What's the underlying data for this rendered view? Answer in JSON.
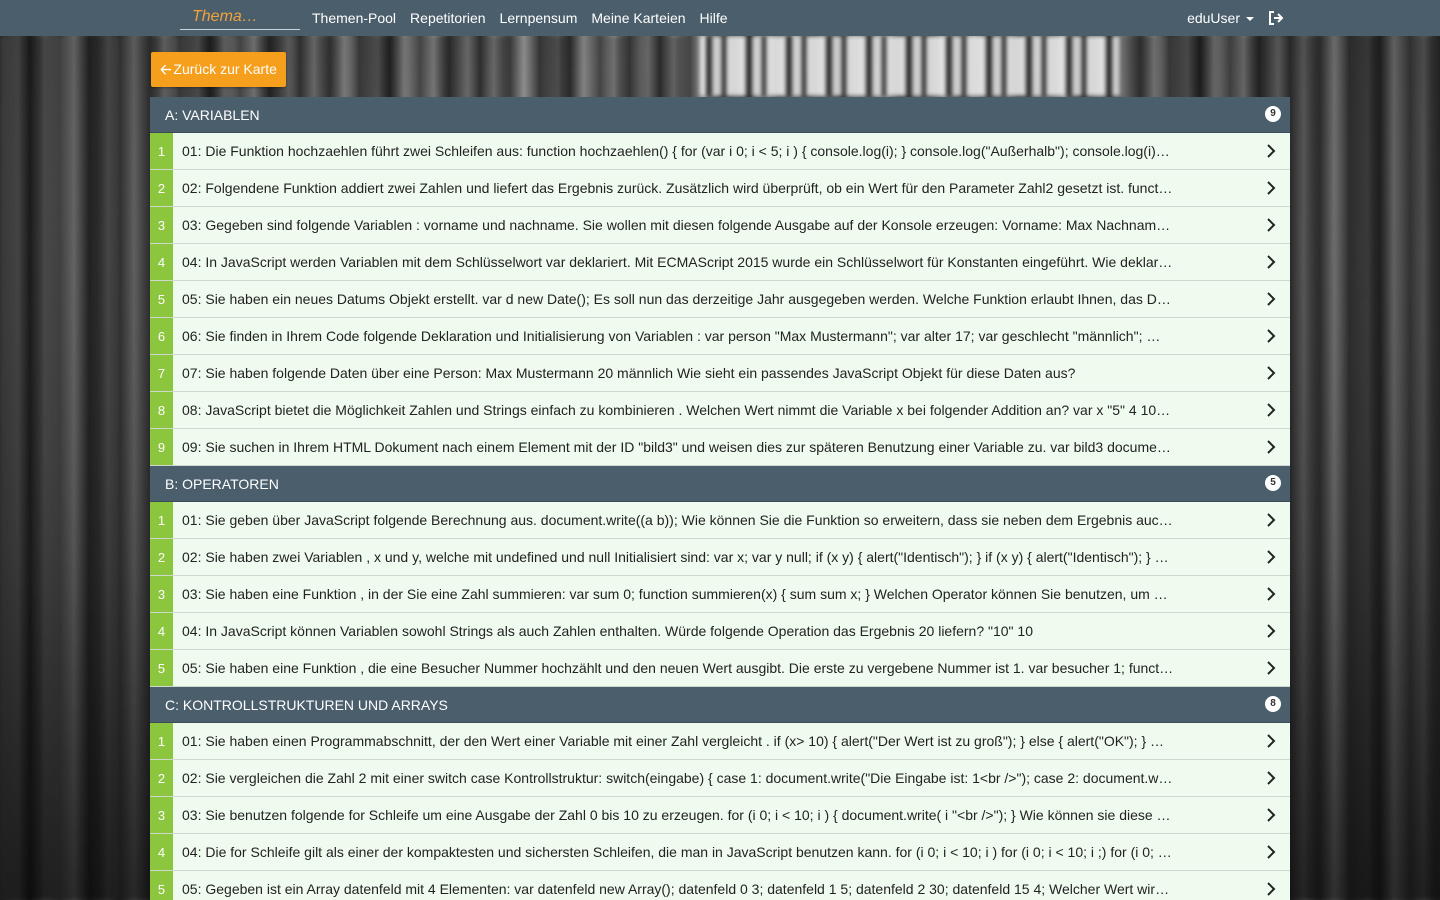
{
  "navbar": {
    "search_placeholder": "Thema…",
    "links": [
      "Themen-Pool",
      "Repetitorien",
      "Lernpensum",
      "Meine Karteien",
      "Hilfe"
    ],
    "user": "eduUser"
  },
  "back_button": {
    "label": "Zurück zur Karte"
  },
  "sections": [
    {
      "title": "A: VARIABLEN",
      "count": "9",
      "items": [
        {
          "num": "1",
          "text": "01: Die Funktion hochzaehlen führt zwei Schleifen aus: function hochzaehlen() { for (var i 0; i < 5; i ) { console.log(i); } console.log(\"Außerhalb\"); console.log(i)…"
        },
        {
          "num": "2",
          "text": "02: Folgendene Funktion addiert zwei Zahlen und liefert das Ergebnis zurück. Zusätzlich wird überprüft, ob ein Wert für den Parameter Zahl2 gesetzt ist. funct…"
        },
        {
          "num": "3",
          "text": "03: Gegeben sind folgende Variablen : vorname und nachname. Sie wollen mit diesen folgende Ausgabe auf der Konsole erzeugen: Vorname: Max Nachnam…"
        },
        {
          "num": "4",
          "text": "04: In JavaScript werden Variablen mit dem Schlüsselwort var deklariert. Mit ECMAScript 2015 wurde ein Schlüsselwort für Konstanten eingeführt. Wie deklar…"
        },
        {
          "num": "5",
          "text": "05: Sie haben ein neues Datums Objekt erstellt. var d new Date(); Es soll nun das derzeitige Jahr ausgegeben werden. Welche Funktion erlaubt Ihnen, das D…"
        },
        {
          "num": "6",
          "text": "06: Sie finden in Ihrem Code folgende Deklaration und Initialisierung von Variablen : var person \"Max Mustermann\"; var alter 17; var geschlecht \"männlich\"; …"
        },
        {
          "num": "7",
          "text": "07: Sie haben folgende Daten über eine Person: Max Mustermann 20 männlich Wie sieht ein passendes JavaScript Objekt für diese Daten aus?"
        },
        {
          "num": "8",
          "text": "08: JavaScript bietet die Möglichkeit Zahlen und Strings einfach zu kombinieren . Welchen Wert nimmt die Variable x bei folgender Addition an? var x \"5\" 4 10…"
        },
        {
          "num": "9",
          "text": "09: Sie suchen in Ihrem HTML Dokument nach einem Element mit der ID \"bild3\" und weisen dies zur späteren Benutzung einer Variable zu. var bild3 docume…"
        }
      ]
    },
    {
      "title": "B: OPERATOREN",
      "count": "5",
      "items": [
        {
          "num": "1",
          "text": "01: Sie geben über JavaScript folgende Berechnung aus. document.write((a b)); Wie können Sie die Funktion so erweitern, dass sie neben dem Ergebnis auc…"
        },
        {
          "num": "2",
          "text": "02: Sie haben zwei Variablen , x und y, welche mit undefined und null Initialisiert sind: var x; var y null; if (x y) { alert(\"Identisch\"); } if (x y) { alert(\"Identisch\"); } …"
        },
        {
          "num": "3",
          "text": "03: Sie haben eine Funktion , in der Sie eine Zahl summieren: var sum 0; function summieren(x) { sum sum x; } Welchen Operator können Sie benutzen, um …"
        },
        {
          "num": "4",
          "text": "04: In JavaScript können Variablen sowohl Strings als auch Zahlen enthalten. Würde folgende Operation das Ergebnis 20 liefern? \"10\" 10"
        },
        {
          "num": "5",
          "text": "05: Sie haben eine Funktion , die eine Besucher Nummer hochzählt und den neuen Wert ausgibt. Die erste zu vergebene Nummer ist 1. var besucher 1; funct…"
        }
      ]
    },
    {
      "title": "C: KONTROLLSTRUKTUREN UND ARRAYS",
      "count": "8",
      "items": [
        {
          "num": "1",
          "text": "01: Sie haben einen Programmabschnitt, der den Wert einer Variable mit einer Zahl vergleicht . if (x> 10) { alert(\"Der Wert ist zu groß\"); } else { alert(\"OK\"); } …"
        },
        {
          "num": "2",
          "text": "02: Sie vergleichen die Zahl 2 mit einer switch case Kontrollstruktur: switch(eingabe) { case 1: document.write(\"Die Eingabe ist: 1<br />\"); case 2: document.w…"
        },
        {
          "num": "3",
          "text": "03: Sie benutzen folgende for Schleife um eine Ausgabe der Zahl 0 bis 10 zu erzeugen. for (i 0; i < 10; i ) { document.write( i \"<br />\"); } Wie können sie diese …"
        },
        {
          "num": "4",
          "text": "04: Die for Schleife gilt als einer der kompaktesten und sichersten Schleifen, die man in JavaScript benutzen kann. for (i 0; i < 10; i ) for (i 0; i < 10; i ;) for (i 0; …"
        },
        {
          "num": "5",
          "text": "05: Gegeben ist ein Array datenfeld mit 4 Elementen: var datenfeld new Array(); datenfeld 0 3; datenfeld 1 5; datenfeld 2 30; datenfeld 15 4; Welcher Wert wir…"
        }
      ]
    }
  ]
}
